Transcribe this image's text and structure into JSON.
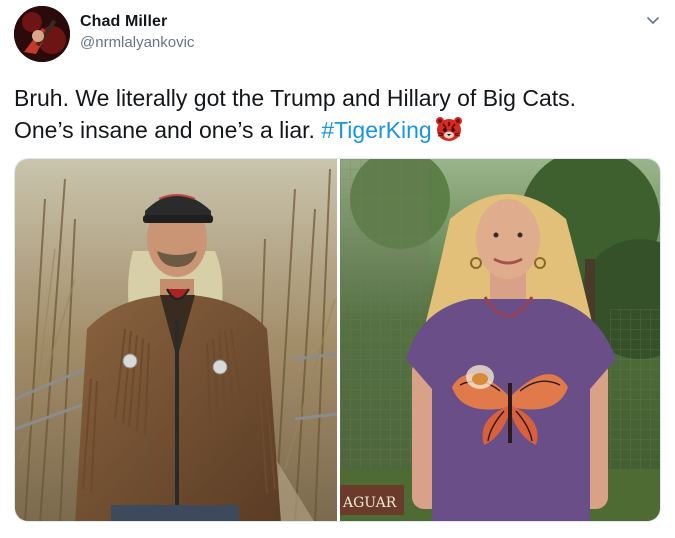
{
  "user": {
    "display_name": "Chad Miller",
    "handle": "@nrmlalyankovic"
  },
  "tweet": {
    "text_line1": "Bruh. We literally got the Trump and Hillary of Big Cats.",
    "text_line2": "One’s insane and one’s a liar.",
    "hashtag": "#TigerKing",
    "emoji": "tiger-face"
  },
  "media": {
    "left_photo": {
      "sign_text": ""
    },
    "right_photo": {
      "sign_text": "AGUAR"
    }
  },
  "colors": {
    "hashtag": "#1b95e0",
    "handle": "#657786"
  }
}
